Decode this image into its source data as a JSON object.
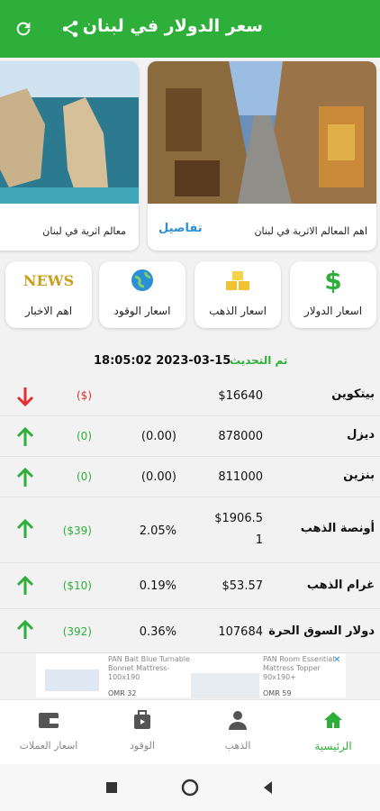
{
  "appbar": {
    "title": "سعر الدولار في لبنان",
    "icons": [
      "share-icon",
      "refresh-icon"
    ],
    "color": "#2eaf3a"
  },
  "carousel": {
    "cards": [
      {
        "caption": "اهم المعالم الاثرية في لبنان",
        "details": "تفاصيل",
        "image": "old-market-street-photo"
      },
      {
        "caption": "معالم اثرية في لبنان",
        "image": "raouche-rocks-photo"
      }
    ]
  },
  "menu": {
    "tiles": [
      {
        "label": "اسعار الدولار",
        "icon": "dollar-icon"
      },
      {
        "label": "اسعار الذهب",
        "icon": "gold-bars-icon"
      },
      {
        "label": "اسعار الوقود",
        "icon": "globe-icon"
      },
      {
        "label": "اهم الاخبار",
        "icon": "news-icon"
      }
    ]
  },
  "update": {
    "label": "تم التحديث",
    "timestamp": "18:05:02 2023-03-15"
  },
  "rows": [
    {
      "name": "بيتكوين",
      "price": "$16640",
      "pct": "",
      "change": "($)",
      "trend": "down"
    },
    {
      "name": "ديزل",
      "price": "878000",
      "pct": "(0.00)",
      "change": "(0)",
      "trend": "up"
    },
    {
      "name": "بنزين",
      "price": "811000",
      "pct": "(0.00)",
      "change": "(0)",
      "trend": "up"
    },
    {
      "name": "أونصة الذهب",
      "price": "$1906.5",
      "price2": "1",
      "pct": "2.05%",
      "change": "($39)",
      "trend": "up"
    },
    {
      "name": "غرام الذهب",
      "price": "$53.57",
      "pct": "0.19%",
      "change": "($10)",
      "trend": "up"
    },
    {
      "name": "دولار السوق الحرة",
      "price": "107684",
      "pct": "0.36%",
      "change": "(392)",
      "trend": "up"
    }
  ],
  "ad": {
    "left_text": "PAN Bait Blue Turnable Bonnet Mattress-100x190",
    "left_price": "OMR 32",
    "right_text": "PAN Room Essential Mattress Topper 90x190+",
    "right_price": "OMR 59"
  },
  "bottomnav": {
    "items": [
      {
        "label": "الرئيسية",
        "icon": "home-icon",
        "active": true
      },
      {
        "label": "الذهب",
        "icon": "person-icon",
        "active": false
      },
      {
        "label": "الوقود",
        "icon": "bag-icon",
        "active": false
      },
      {
        "label": "اسعار العملات",
        "icon": "wallet-icon",
        "active": false
      }
    ]
  },
  "colors": {
    "up": "#2eaf3a",
    "down": "#e03030",
    "accent": "#2eaf3a",
    "link": "#2a8fd6"
  }
}
